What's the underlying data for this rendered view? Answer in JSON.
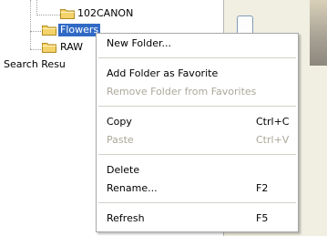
{
  "tree": {
    "items": [
      {
        "label": "102CANON"
      },
      {
        "label": "Flowers"
      },
      {
        "label": "RAW"
      },
      {
        "label": "Search Resu"
      }
    ]
  },
  "context_menu": {
    "items": [
      {
        "label": "New Folder...",
        "shortcut": ""
      },
      {
        "label": "Add Folder as Favorite",
        "shortcut": ""
      },
      {
        "label": "Remove Folder from Favorites",
        "shortcut": ""
      },
      {
        "label": "Copy",
        "shortcut": "Ctrl+C"
      },
      {
        "label": "Paste",
        "shortcut": "Ctrl+V"
      },
      {
        "label": "Delete",
        "shortcut": ""
      },
      {
        "label": "Rename...",
        "shortcut": "F2"
      },
      {
        "label": "Refresh",
        "shortcut": "F5"
      }
    ]
  },
  "colors": {
    "selection": "#316ac5",
    "folder": "#f5d36b",
    "disabled_text": "#aca899"
  }
}
